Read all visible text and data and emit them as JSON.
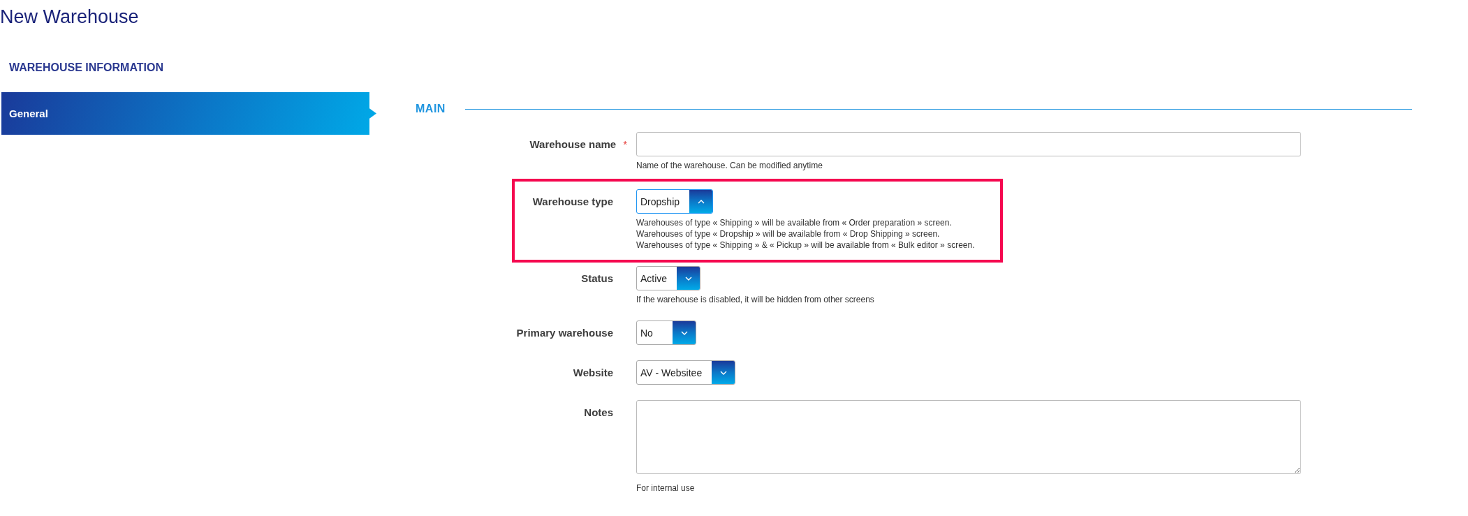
{
  "page": {
    "title": "New Warehouse"
  },
  "sidebar": {
    "heading": "WAREHOUSE INFORMATION",
    "items": [
      {
        "label": "General",
        "selected": true
      }
    ]
  },
  "section": {
    "title": "MAIN"
  },
  "fields": [
    {
      "kind": "text",
      "label": "Warehouse name",
      "required_mark": "*",
      "help": [
        "Name of the warehouse. Can be modified anytime"
      ]
    },
    {
      "kind": "select",
      "label": "Warehouse type",
      "value": "Dropship",
      "expanded": true,
      "highlighted": true,
      "help": [
        "Warehouses of type « Shipping » will be available from « Order preparation » screen.",
        "Warehouses of type « Dropship » will be available from « Drop Shipping » screen.",
        "Warehouses of type « Shipping » & « Pickup » will be available from « Bulk editor » screen."
      ]
    },
    {
      "kind": "select",
      "label": "Status",
      "value": "Active",
      "expanded": false,
      "help": [
        "If the warehouse is disabled, it will be hidden from other screens"
      ]
    },
    {
      "kind": "select",
      "label": "Primary warehouse",
      "value": "No",
      "expanded": false
    },
    {
      "kind": "select",
      "label": "Website",
      "value": "AV - Websitee",
      "expanded": false
    },
    {
      "kind": "textarea",
      "label": "Notes",
      "help": [
        "For internal use"
      ]
    }
  ]
}
